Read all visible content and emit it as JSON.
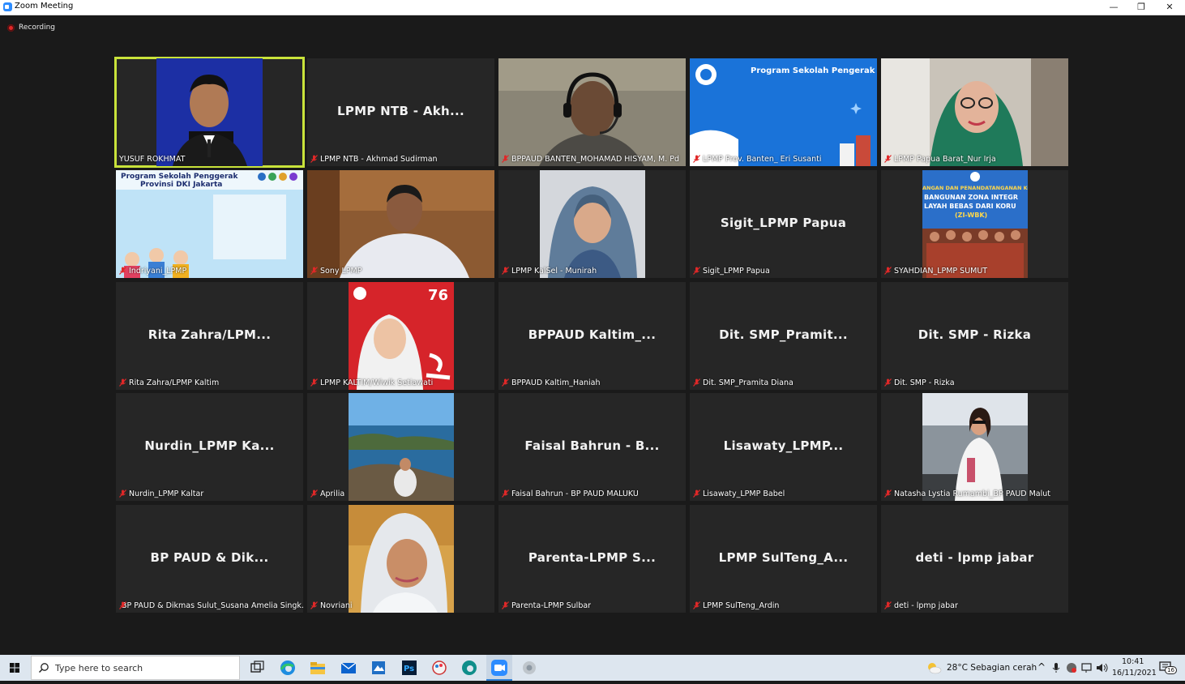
{
  "window": {
    "title": "Zoom Meeting",
    "minimize_glyph": "—",
    "restore_glyph": "❐",
    "close_glyph": "✕"
  },
  "recording": {
    "label": "Recording"
  },
  "tiles": [
    {
      "display": "",
      "label": "YUSUF ROKHMAT",
      "kind": "photo",
      "icon": "man-suit-photo"
    },
    {
      "display": "LPMP NTB - Akh...",
      "label": "LPMP NTB - Akhmad Sudirman",
      "kind": "name"
    },
    {
      "display": "",
      "label": "BPPAUD BANTEN_MOHAMAD HISYAM, M. Pd",
      "kind": "photo",
      "icon": "headset-man-photo"
    },
    {
      "display": "",
      "label": "LPMP Prov. Banten_ Eri Susanti",
      "kind": "photo",
      "icon": "program-banner"
    },
    {
      "display": "",
      "label": "LPMP Papua Barat_Nur Irja",
      "kind": "photo",
      "icon": "woman-hijab-photo"
    },
    {
      "display": "",
      "label": "Indriyani_LPMP",
      "kind": "photo",
      "icon": "program-banner-dki"
    },
    {
      "display": "",
      "label": "Sony LPMP",
      "kind": "photo",
      "icon": "man-office-photo"
    },
    {
      "display": "",
      "label": "LPMP KalSel - Munirah",
      "kind": "photo",
      "icon": "woman-hijab-photo"
    },
    {
      "display": "Sigit_LPMP Papua",
      "label": "Sigit_LPMP Papua",
      "kind": "name"
    },
    {
      "display": "",
      "label": "SYAHDIAN_LPMP SUMUT",
      "kind": "photo",
      "icon": "group-banner-photo"
    },
    {
      "display": "Rita Zahra/LPM...",
      "label": "Rita Zahra/LPMP Kaltim",
      "kind": "name"
    },
    {
      "display": "",
      "label": "LPMP KALTIM/Wiwik Setiawati",
      "kind": "photo",
      "icon": "red-76-poster"
    },
    {
      "display": "BPPAUD Kaltim_...",
      "label": "BPPAUD Kaltim_Haniah",
      "kind": "name"
    },
    {
      "display": "Dit. SMP_Pramit...",
      "label": "Dit. SMP_Pramita Diana",
      "kind": "name"
    },
    {
      "display": "Dit. SMP - Rizka",
      "label": "Dit. SMP - Rizka",
      "kind": "name"
    },
    {
      "display": "Nurdin_LPMP Ka...",
      "label": "Nurdin_LPMP Kaltar",
      "kind": "name"
    },
    {
      "display": "",
      "label": "Aprilia",
      "kind": "photo",
      "icon": "island-photo"
    },
    {
      "display": "Faisal Bahrun - B...",
      "label": "Faisal Bahrun - BP PAUD MALUKU",
      "kind": "name"
    },
    {
      "display": "Lisawaty_LPMP...",
      "label": "Lisawaty_LPMP Babel",
      "kind": "name"
    },
    {
      "display": "",
      "label": "Natasha Lystia Rumambi_BP PAUD Malut",
      "kind": "photo",
      "icon": "woman-city-photo"
    },
    {
      "display": "BP PAUD & Dik...",
      "label": "BP PAUD & Dikmas Sulut_Susana Amelia Singk...",
      "kind": "name"
    },
    {
      "display": "",
      "label": "Novriani",
      "kind": "photo",
      "icon": "woman-hijab-selfie"
    },
    {
      "display": "Parenta-LPMP S...",
      "label": "Parenta-LPMP Sulbar",
      "kind": "name"
    },
    {
      "display": "LPMP SulTeng_A...",
      "label": "LPMP SulTeng_Ardin",
      "kind": "name"
    },
    {
      "display": "deti - lpmp jabar",
      "label": "deti - lpmp jabar",
      "kind": "name"
    }
  ],
  "banners": {
    "banten": "Program Sekolah Pengerak",
    "dki_line1": "Program Sekolah Penggerak",
    "dki_line2": "Provinsi DKI Jakarta",
    "seventy_six": "76",
    "zi_line1": "ANGAN DAN PENANDATANGANAN KO",
    "zi_line2": "BANGUNAN ZONA INTEGR",
    "zi_line3": "LAYAH BEBAS DARI KORU",
    "zi_line4": "(ZI-WBK)"
  },
  "taskbar": {
    "search_placeholder": "Type here to search",
    "weather": "28°C  Sebagian cerah",
    "time": "10:41",
    "date": "16/11/2021",
    "notification_count": "16"
  }
}
